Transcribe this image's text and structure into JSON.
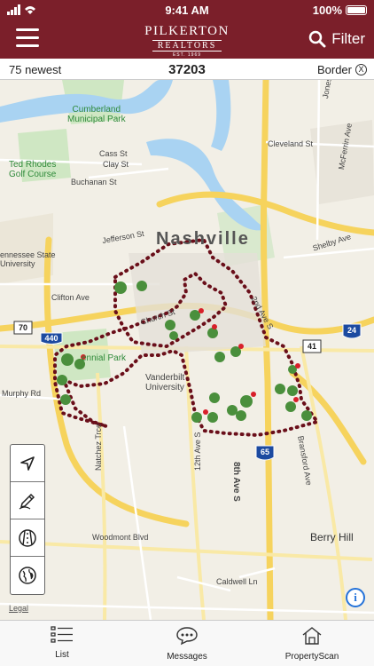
{
  "status": {
    "time": "9:41 AM",
    "battery": "100%"
  },
  "header": {
    "brand_name": "PILKERTON",
    "brand_sub": "REALTORS",
    "brand_est": "EST. 1969",
    "filter_label": "Filter"
  },
  "filter_row": {
    "newest": "75 newest",
    "zip": "37203",
    "border": "Border",
    "clear": "X"
  },
  "map": {
    "labels": {
      "city": "Nashville",
      "cumberland": "Cumberland\nMunicipal Park",
      "ted_rhodes": "Ted Rhodes\nGolf Course",
      "cass": "Cass St",
      "clay": "Clay St",
      "buchanan": "Buchanan St",
      "cleveland": "Cleveland St",
      "mcferrin": "McFerrin Ave",
      "jones": "Jones",
      "shelby": "Shelby Ave",
      "jefferson": "Jefferson St",
      "tsu": "ennessee State\nUniversity",
      "clifton": "Clifton Ave",
      "church": "Church St",
      "second_ave": "2nd Ave S",
      "centennial": "ennial Park",
      "vanderbilt": "Vanderbilt\nUniversity",
      "murphy": "Murphy Rd",
      "natchez": "Natchez Trce",
      "twelfth": "12th Ave S",
      "eighth": "8th Ave S",
      "bransford": "Bransford Ave",
      "woodmont": "Woodmont Blvd",
      "berry_hill": "Berry Hill",
      "caldwell": "Caldwell Ln",
      "shield_440": "440",
      "shield_70": "70",
      "shield_41": "41",
      "shield_24": "24",
      "shield_65": "65"
    },
    "legal": "Legal"
  },
  "tabs": [
    {
      "label": "List",
      "icon": "list-icon"
    },
    {
      "label": "Messages",
      "icon": "chat-icon"
    },
    {
      "label": "PropertyScan",
      "icon": "house-scan-icon"
    }
  ],
  "colors": {
    "brand": "#7b1f2a",
    "border_dots": "#6a0f1a",
    "info": "#2573d9"
  }
}
